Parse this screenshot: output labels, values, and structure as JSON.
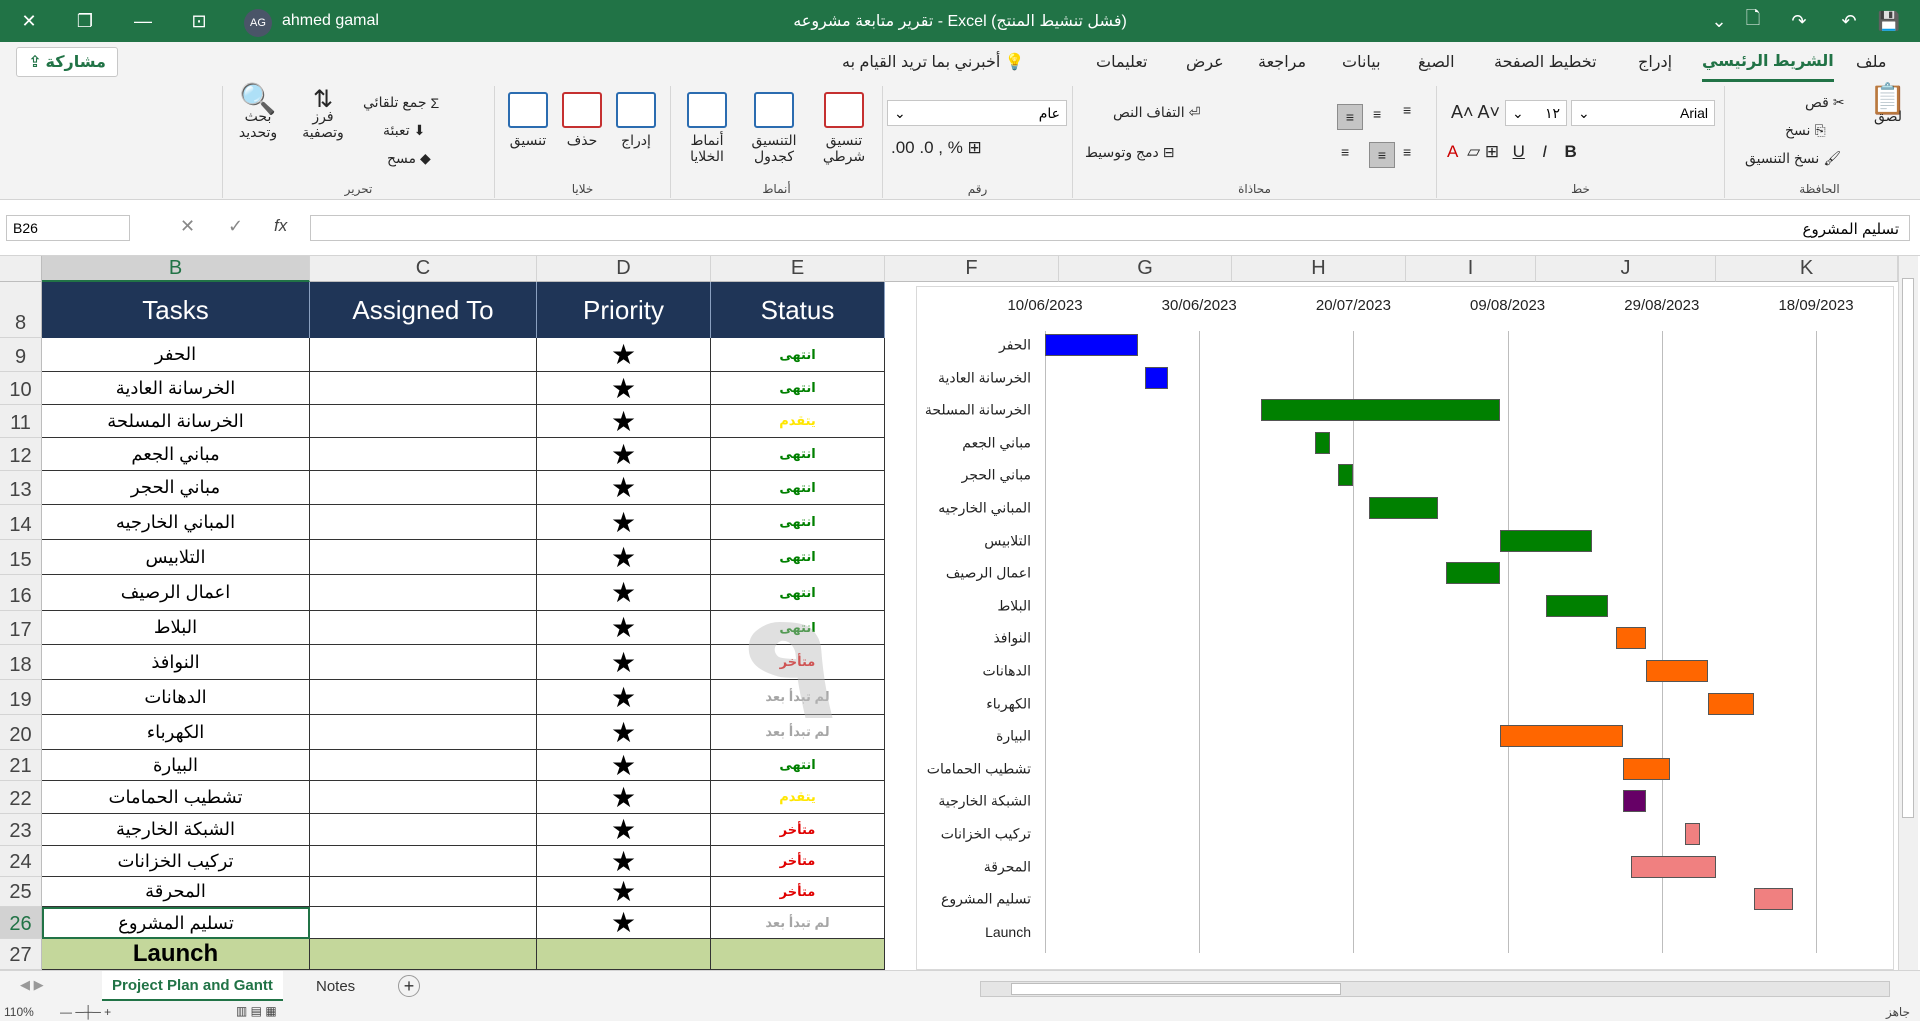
{
  "titlebar": {
    "title": "تقرير متابعة مشروعه  -  Excel (فشل تنشيط المنتج)",
    "user_name": "ahmed gamal",
    "user_initials": "AG"
  },
  "menubar": {
    "share_label": "مشاركة",
    "items": [
      "ملف",
      "الشريط الرئيسي",
      "إدراج",
      "تخطيط الصفحة",
      "الصيغ",
      "بيانات",
      "مراجعة",
      "عرض",
      "تعليمات"
    ],
    "tell_me": "أخبرني بما تريد القيام به"
  },
  "ribbon": {
    "clipboard": {
      "label": "الحافظة",
      "paste": "لصق",
      "cut": "قص",
      "copy": "نسخ",
      "format_painter": "نسخ التنسيق"
    },
    "font": {
      "label": "خط",
      "name": "Arial",
      "size": "١٢"
    },
    "alignment": {
      "label": "محاذاة",
      "wrap": "التفاف النص",
      "merge": "دمج وتوسيط"
    },
    "number": {
      "label": "رقم",
      "format": "عام"
    },
    "styles": {
      "label": "أنماط",
      "conditional": "تنسيق شرطي",
      "table": "التنسيق كجدول",
      "cell_styles": "أنماط الخلايا"
    },
    "cells": {
      "label": "خلايا",
      "insert": "إدراج",
      "delete": "حذف",
      "format": "تنسيق"
    },
    "editing": {
      "label": "تحرير",
      "autosum": "جمع تلقائي",
      "fill": "تعبئة",
      "clear": "مسح",
      "sort": "فرز وتصفية",
      "find": "بحث وتحديد"
    }
  },
  "formula_bar": {
    "name_box": "B26",
    "fx": "fx",
    "content": "تسليم المشروع"
  },
  "columns": [
    "B",
    "C",
    "D",
    "E",
    "F",
    "G",
    "H",
    "I",
    "J",
    "K"
  ],
  "rows": [
    "8",
    "9",
    "10",
    "11",
    "12",
    "13",
    "14",
    "15",
    "16",
    "17",
    "18",
    "19",
    "20",
    "21",
    "22",
    "23",
    "24",
    "25",
    "26",
    "27"
  ],
  "table": {
    "headers": {
      "tasks": "Tasks",
      "assigned": "Assigned To",
      "priority": "Priority",
      "status": "Status"
    },
    "star": "★",
    "status_colors": {
      "done": "#008000",
      "progress": "#ffe600",
      "late": "#e00000",
      "notstarted": "#a6a6a6"
    },
    "rows": [
      {
        "task": "الحفر",
        "status": "انتهى",
        "kind": "done"
      },
      {
        "task": "الخرسانة العادية",
        "status": "انتهى",
        "kind": "done"
      },
      {
        "task": "الخرسانة المسلحة",
        "status": "يتقدم",
        "kind": "progress"
      },
      {
        "task": "مباني الجعم",
        "status": "انتهى",
        "kind": "done"
      },
      {
        "task": "مباني الحجر",
        "status": "انتهى",
        "kind": "done"
      },
      {
        "task": "المباني الخارجيه",
        "status": "انتهى",
        "kind": "done"
      },
      {
        "task": "التلابيس",
        "status": "انتهى",
        "kind": "done"
      },
      {
        "task": "اعمال الرصيف",
        "status": "انتهى",
        "kind": "done"
      },
      {
        "task": "البلاط",
        "status": "انتهى",
        "kind": "done"
      },
      {
        "task": "النوافذ",
        "status": "متأخر",
        "kind": "late"
      },
      {
        "task": "الدهانات",
        "status": "لم تبدأ بعد",
        "kind": "notstarted"
      },
      {
        "task": "الكهرباء",
        "status": "لم تبدأ بعد",
        "kind": "notstarted"
      },
      {
        "task": "البيارة",
        "status": "انتهى",
        "kind": "done"
      },
      {
        "task": "تشطيب الحمامات",
        "status": "يتقدم",
        "kind": "progress"
      },
      {
        "task": "الشبكة الخارجية",
        "status": "متأخر",
        "kind": "late"
      },
      {
        "task": "تركيب الخزانات",
        "status": "متأخر",
        "kind": "late"
      },
      {
        "task": "المحرقة",
        "status": "متأخر",
        "kind": "late"
      },
      {
        "task": "تسليم المشروع",
        "status": "لم تبدأ بعد",
        "kind": "notstarted"
      }
    ],
    "launch": "Launch"
  },
  "chart_data": {
    "type": "bar",
    "orientation": "horizontal-gantt",
    "x_ticks": [
      "10/06/2023",
      "30/06/2023",
      "20/07/2023",
      "09/08/2023",
      "29/08/2023",
      "18/09/2023"
    ],
    "categories": [
      "الحفر",
      "الخرسانة العادية",
      "الخرسانة المسلحة",
      "مباني الجعم",
      "مباني الحجر",
      "المباني الخارجيه",
      "التلابيس",
      "اعمال الرصيف",
      "البلاط",
      "النوافذ",
      "الدهانات",
      "الكهرباء",
      "البيارة",
      "تشطيب الحمامات",
      "الشبكة الخارجية",
      "تركيب الخزانات",
      "المحرقة",
      "تسليم المشروع",
      "Launch"
    ],
    "bars": [
      {
        "task": "الحفر",
        "start": "2023-06-10",
        "end": "2023-06-22",
        "color": "#0000ff"
      },
      {
        "task": "الخرسانة العادية",
        "start": "2023-06-23",
        "end": "2023-06-26",
        "color": "#0000ff"
      },
      {
        "task": "الخرسانة المسلحة",
        "start": "2023-07-08",
        "end": "2023-08-08",
        "color": "#008000"
      },
      {
        "task": "مباني الجعم",
        "start": "2023-07-15",
        "end": "2023-07-17",
        "color": "#008000"
      },
      {
        "task": "مباني الحجر",
        "start": "2023-07-18",
        "end": "2023-07-20",
        "color": "#008000"
      },
      {
        "task": "المباني الخارجيه",
        "start": "2023-07-22",
        "end": "2023-07-31",
        "color": "#008000"
      },
      {
        "task": "التلابيس",
        "start": "2023-08-08",
        "end": "2023-08-20",
        "color": "#008000"
      },
      {
        "task": "اعمال الرصيف",
        "start": "2023-08-01",
        "end": "2023-08-08",
        "color": "#008000"
      },
      {
        "task": "البلاط",
        "start": "2023-08-14",
        "end": "2023-08-22",
        "color": "#008000"
      },
      {
        "task": "النوافذ",
        "start": "2023-08-23",
        "end": "2023-08-27",
        "color": "#ff6600"
      },
      {
        "task": "الدهانات",
        "start": "2023-08-27",
        "end": "2023-09-04",
        "color": "#ff6600"
      },
      {
        "task": "الكهرباء",
        "start": "2023-09-04",
        "end": "2023-09-10",
        "color": "#ff6600"
      },
      {
        "task": "البيارة",
        "start": "2023-08-08",
        "end": "2023-08-24",
        "color": "#ff6600"
      },
      {
        "task": "تشطيب الحمامات",
        "start": "2023-08-24",
        "end": "2023-08-30",
        "color": "#ff6600"
      },
      {
        "task": "الشبكة الخارجية",
        "start": "2023-08-24",
        "end": "2023-08-27",
        "color": "#660066"
      },
      {
        "task": "تركيب الخزانات",
        "start": "2023-09-01",
        "end": "2023-09-03",
        "color": "#f08080"
      },
      {
        "task": "المحرقة",
        "start": "2023-08-25",
        "end": "2023-09-05",
        "color": "#f08080"
      },
      {
        "task": "تسليم المشروع",
        "start": "2023-09-10",
        "end": "2023-09-15",
        "color": "#f08080"
      }
    ]
  },
  "sheets": {
    "active": "Project Plan and Gantt",
    "other": "Notes",
    "add": "+"
  },
  "statusbar": {
    "ready": "جاهز",
    "zoom": "110%"
  }
}
